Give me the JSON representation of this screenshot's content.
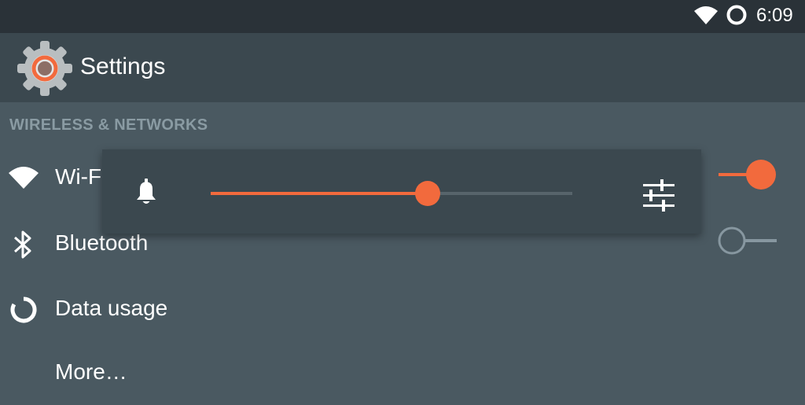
{
  "status_bar": {
    "time": "6:09",
    "icons": [
      "wifi-icon",
      "data-saver-icon"
    ]
  },
  "toolbar": {
    "title": "Settings",
    "icon": "settings-gear-icon"
  },
  "section": {
    "header": "WIRELESS & NETWORKS"
  },
  "items": [
    {
      "label": "Wi-Fi",
      "icon": "wifi-icon",
      "toggle": "on"
    },
    {
      "label": "Bluetooth",
      "icon": "bluetooth-icon",
      "toggle": "off"
    },
    {
      "label": "Data usage",
      "icon": "data-usage-icon"
    },
    {
      "label": "More…"
    }
  ],
  "volume_panel": {
    "icon": "bell-icon",
    "level": 0.6,
    "settings_icon": "equalizer-icon"
  },
  "colors": {
    "accent": "#f26a3d",
    "status_bar": "#2a3238",
    "toolbar": "#3b484f",
    "background": "#4a5961",
    "section_header": "#8a9ba3"
  }
}
